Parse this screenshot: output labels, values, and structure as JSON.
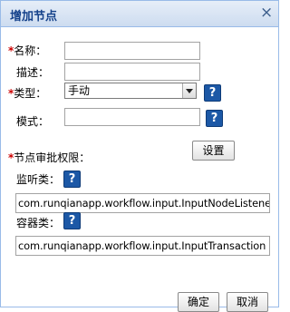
{
  "dialog": {
    "title": "增加节点",
    "close_symbol": "×"
  },
  "form": {
    "required_mark": "*",
    "name_label": "名称：",
    "name_value": "",
    "desc_label": "描述：",
    "desc_value": "",
    "type_label": "类型：",
    "type_value": "手动",
    "help_symbol": "?",
    "mode_label": "模式：",
    "mode_value": "",
    "permission_label": "节点审批权限：",
    "settings_button": "设置",
    "listener_label": "监听类：",
    "listener_value": "com.runqianapp.workflow.input.InputNodeListener",
    "container_label": "容器类：",
    "container_value": "com.runqianapp.workflow.input.InputTransaction"
  },
  "footer": {
    "ok_label": "确定",
    "cancel_label": "取消"
  }
}
